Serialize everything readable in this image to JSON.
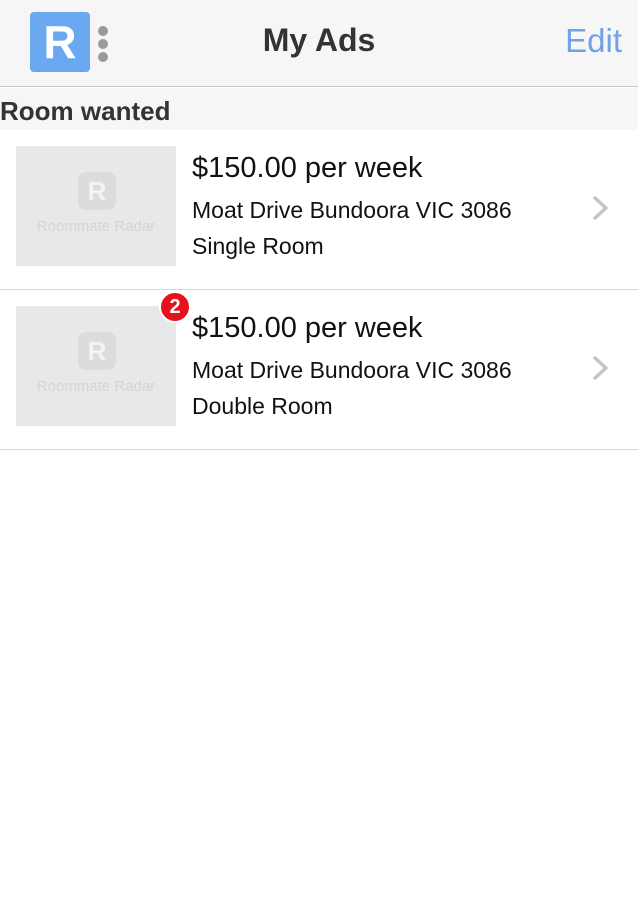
{
  "navbar": {
    "logo_letter": "R",
    "title": "My Ads",
    "edit_label": "Edit"
  },
  "section": {
    "title": "Room wanted"
  },
  "placeholder": {
    "letter": "R",
    "text": "Roommate Radar"
  },
  "ads": [
    {
      "price": "$150.00 per week",
      "address": "Moat Drive Bundoora VIC 3086",
      "room_type": "Single Room",
      "badge": ""
    },
    {
      "price": "$150.00 per week",
      "address": "Moat Drive Bundoora VIC 3086",
      "room_type": "Double Room",
      "badge": "2"
    }
  ],
  "colors": {
    "accent": "#6fa3e6",
    "logo_bg": "#6aa8f2",
    "badge": "#e8101a"
  }
}
